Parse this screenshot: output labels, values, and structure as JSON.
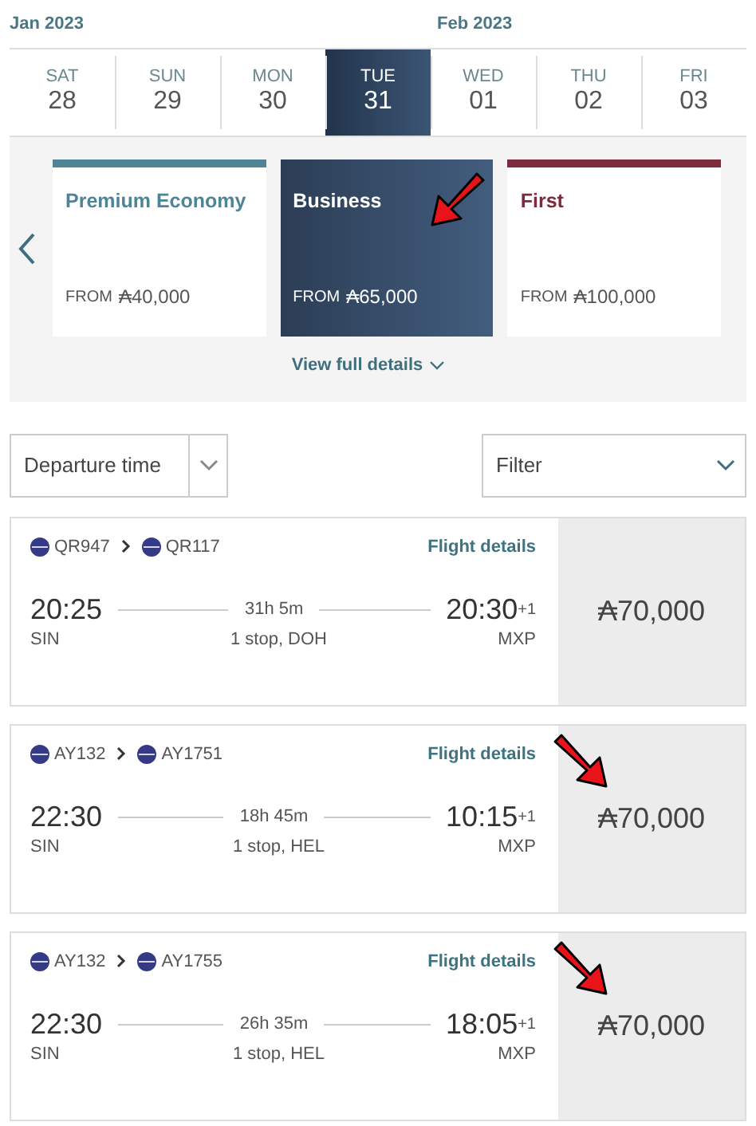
{
  "dates": [
    {
      "month": "Jan 2023",
      "day": "SAT",
      "date": "28",
      "selected": false
    },
    {
      "day": "SUN",
      "date": "29",
      "selected": false
    },
    {
      "day": "MON",
      "date": "30",
      "selected": false
    },
    {
      "day": "TUE",
      "date": "31",
      "selected": true
    },
    {
      "month": "Feb 2023",
      "day": "WED",
      "date": "01",
      "selected": false
    },
    {
      "day": "THU",
      "date": "02",
      "selected": false
    },
    {
      "day": "FRI",
      "date": "03",
      "selected": false
    }
  ],
  "cabins": [
    {
      "name": "Premium Economy",
      "from": "FROM",
      "price": "₳40,000",
      "color": "#4d8596",
      "selected": false,
      "highlighted": false
    },
    {
      "name": "Business",
      "from": "FROM",
      "price": "₳65,000",
      "color": "#2c3d55",
      "selected": true,
      "highlighted": true
    },
    {
      "name": "First",
      "from": "FROM",
      "price": "₳100,000",
      "color": "#7d2b3c",
      "selected": false,
      "highlighted": false
    }
  ],
  "view_details": "View full details",
  "dropdowns": [
    {
      "label": "Departure time"
    },
    {
      "label": "Filter"
    }
  ],
  "flights": [
    {
      "segments": [
        "QR947",
        "QR117"
      ],
      "details_link": "Flight details",
      "depart_time": "20:25",
      "depart_airport": "SIN",
      "duration": "31h 5m",
      "stops": "1 stop, DOH",
      "arrive_time": "20:30",
      "day_offset": "+1",
      "arrive_airport": "MXP",
      "price": "₳70,000",
      "highlighted": false
    },
    {
      "segments": [
        "AY132",
        "AY1751"
      ],
      "details_link": "Flight details",
      "depart_time": "22:30",
      "depart_airport": "SIN",
      "duration": "18h 45m",
      "stops": "1 stop, HEL",
      "arrive_time": "10:15",
      "day_offset": "+1",
      "arrive_airport": "MXP",
      "price": "₳70,000",
      "highlighted": true
    },
    {
      "segments": [
        "AY132",
        "AY1755"
      ],
      "details_link": "Flight details",
      "depart_time": "22:30",
      "depart_airport": "SIN",
      "duration": "26h 35m",
      "stops": "1 stop, HEL",
      "arrive_time": "18:05",
      "day_offset": "+1",
      "arrive_airport": "MXP",
      "price": "₳70,000",
      "highlighted": true
    }
  ]
}
